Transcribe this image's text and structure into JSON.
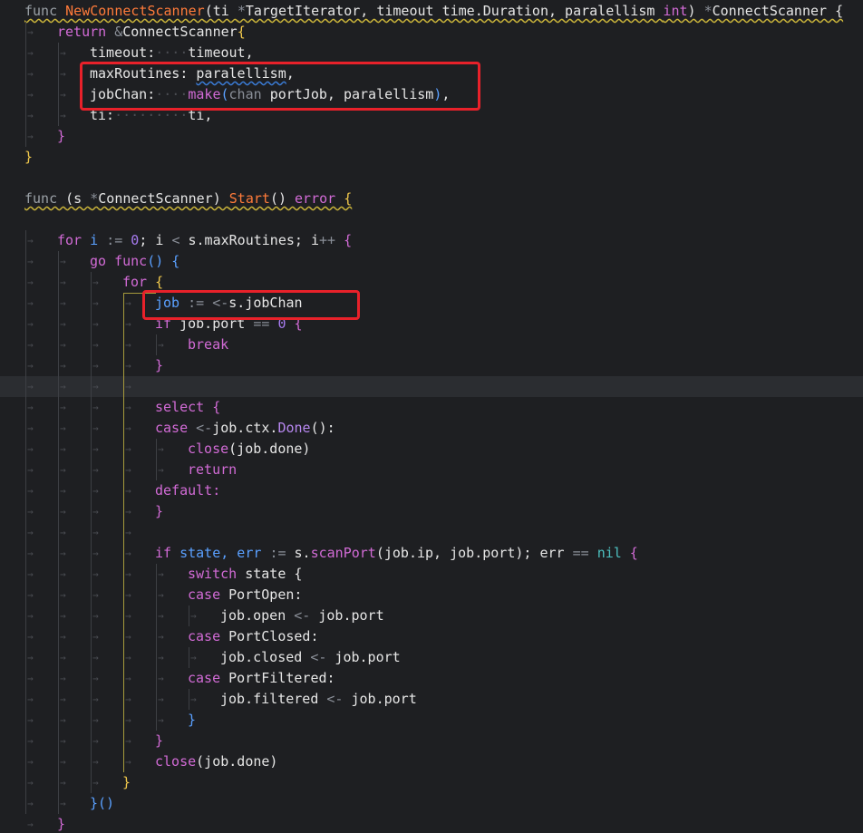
{
  "lines": [
    [
      "func ",
      "NewConnectScanner",
      "(ti ",
      "*",
      "TargetIterator, timeout time.Duration, paralellism ",
      "int",
      ") ",
      "*",
      "ConnectScanner {"
    ],
    [
      "return ",
      "&",
      "ConnectScanner",
      "{"
    ],
    [
      "timeout:",
      "····",
      "timeout,"
    ],
    [
      "maxRoutines: ",
      "paralellism",
      ","
    ],
    [
      "jobChan:",
      "····",
      "make",
      "(",
      "chan ",
      "portJob, paralellism",
      ")",
      ","
    ],
    [
      "ti:",
      "·········",
      "ti,"
    ],
    [
      "}"
    ],
    [
      "}"
    ],
    [
      ""
    ],
    [
      "func ",
      "(s ",
      "*",
      "ConnectScanner) ",
      "Start",
      "() ",
      "error",
      " {"
    ],
    [
      ""
    ],
    [
      "for ",
      "i ",
      ":=",
      " ",
      "0",
      "; i ",
      "<",
      " s.maxRoutines; i",
      "++",
      " {"
    ],
    [
      "go ",
      "func",
      "() {"
    ],
    [
      "for ",
      "{"
    ],
    [
      "job ",
      ":=",
      " ",
      "<-",
      "s.jobChan"
    ],
    [
      "if ",
      "job.port ",
      "==",
      " ",
      "0",
      " {"
    ],
    [
      "break"
    ],
    [
      "}"
    ],
    [
      ""
    ],
    [
      "select ",
      "{"
    ],
    [
      "case ",
      "<-",
      "job.ctx.",
      "Done",
      "():"
    ],
    [
      "close",
      "(job.done)"
    ],
    [
      "return"
    ],
    [
      "default:"
    ],
    [
      "}"
    ],
    [
      ""
    ],
    [
      "if ",
      "state, err ",
      ":=",
      " s.",
      "scanPort",
      "(job.ip, job.port); err ",
      "==",
      " ",
      "nil",
      " {"
    ],
    [
      "switch ",
      "state {"
    ],
    [
      "case ",
      "PortOpen:"
    ],
    [
      "job.open ",
      "<-",
      " job.port"
    ],
    [
      "case ",
      "PortClosed:"
    ],
    [
      "job.closed ",
      "<-",
      " job.port"
    ],
    [
      "case ",
      "PortFiltered:"
    ],
    [
      "job.filtered ",
      "<-",
      " job.port"
    ],
    [
      "}"
    ],
    [
      "}"
    ],
    [
      "close",
      "(job.done)"
    ],
    [
      "}"
    ],
    [
      "}()"
    ],
    [
      "}"
    ]
  ],
  "ws_marker": "→",
  "highlight_color": "#e8212a"
}
